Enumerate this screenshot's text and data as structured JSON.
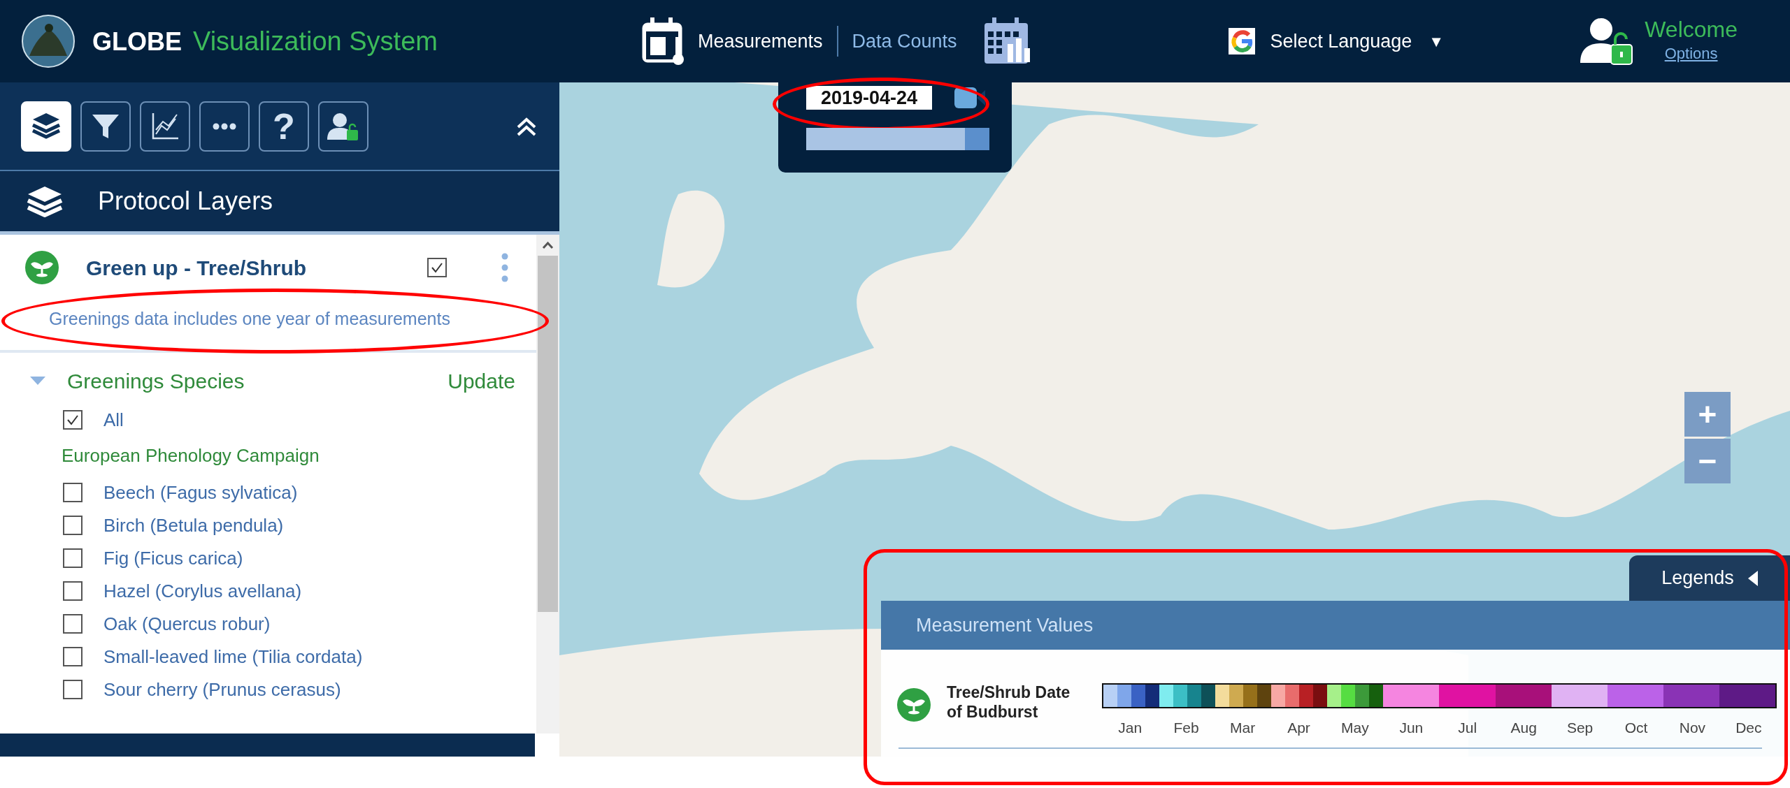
{
  "header": {
    "brand": "GLOBE",
    "subtitle": "Visualization System",
    "views": [
      {
        "kind": "measurements",
        "label": "Measurements",
        "selected": true
      },
      {
        "kind": "counts",
        "label": "Data Counts",
        "selected": false
      }
    ],
    "language": {
      "label": "Select Language",
      "caret": "▼"
    },
    "user": {
      "greeting": "Welcome",
      "link": "Options"
    }
  },
  "toolbar": {
    "buttons": [
      {
        "kind": "layers",
        "selected": true
      },
      {
        "kind": "filter",
        "selected": false
      },
      {
        "kind": "chart",
        "selected": false
      },
      {
        "kind": "more",
        "selected": false
      },
      {
        "kind": "help",
        "glyph": "?",
        "selected": false
      },
      {
        "kind": "user",
        "selected": false
      }
    ]
  },
  "sidebar": {
    "title": "Protocol Layers",
    "layer": {
      "title": "Green up - Tree/Shrub",
      "checked": true,
      "note": "Greenings data includes one year of measurements",
      "note_highlighted": true
    },
    "species": {
      "title": "Greenings Species",
      "expanded": true,
      "action": "Update",
      "items": [
        {
          "kind": "check",
          "label": "All",
          "checked": true
        },
        {
          "kind": "group",
          "label": "European Phenology Campaign"
        },
        {
          "kind": "check",
          "label": "Beech (Fagus sylvatica)",
          "checked": false
        },
        {
          "kind": "check",
          "label": "Birch (Betula pendula)",
          "checked": false
        },
        {
          "kind": "check",
          "label": "Fig (Ficus carica)",
          "checked": false
        },
        {
          "kind": "check",
          "label": "Hazel (Corylus avellana)",
          "checked": false
        },
        {
          "kind": "check",
          "label": "Oak (Quercus robur)",
          "checked": false
        },
        {
          "kind": "check",
          "label": "Small-leaved lime (Tilia cordata)",
          "checked": false
        },
        {
          "kind": "check",
          "label": "Sour cherry (Prunus cerasus)",
          "checked": false
        }
      ]
    }
  },
  "date_control": {
    "date": "2019-04-24",
    "highlighted": true,
    "level": 1.0
  },
  "map": {
    "zoom_buttons": [
      "+",
      "−"
    ]
  },
  "legend": {
    "tab": "Legends",
    "panel_title": "Measurement Values",
    "highlighted": true,
    "entry": {
      "label": "Tree/Shrub Date of Budburst",
      "months": [
        {
          "label": "Jan",
          "swatches": [
            {
              "color": "#b8d0f5"
            },
            {
              "color": "#7fa6ea"
            },
            {
              "color": "#3a62c4"
            },
            {
              "color": "#142c78"
            }
          ]
        },
        {
          "label": "Feb",
          "swatches": [
            {
              "color": "#7fecef"
            },
            {
              "color": "#3cbfc5"
            },
            {
              "color": "#17848e"
            },
            {
              "color": "#0e5058"
            }
          ]
        },
        {
          "label": "Mar",
          "swatches": [
            {
              "color": "#f3dc9c"
            },
            {
              "color": "#cfaa50"
            },
            {
              "color": "#96701a"
            },
            {
              "color": "#5e430e"
            }
          ]
        },
        {
          "label": "Apr",
          "swatches": [
            {
              "color": "#f7a8a4"
            },
            {
              "color": "#e86c6c"
            },
            {
              "color": "#b82024"
            },
            {
              "color": "#7a0e10"
            }
          ]
        },
        {
          "label": "May",
          "swatches": [
            {
              "color": "#a6f08a"
            },
            {
              "color": "#56dd42"
            },
            {
              "color": "#3c9a3a"
            },
            {
              "color": "#16600e"
            }
          ]
        },
        {
          "label": "Jun",
          "swatches": [
            {
              "color": "#f585e0"
            }
          ]
        },
        {
          "label": "Jul",
          "swatches": [
            {
              "color": "#e012a2"
            }
          ]
        },
        {
          "label": "Aug",
          "swatches": [
            {
              "color": "#a8107a"
            }
          ]
        },
        {
          "label": "Sep",
          "swatches": [
            {
              "color": "#e0b2f3"
            }
          ]
        },
        {
          "label": "Oct",
          "swatches": [
            {
              "color": "#bb62e8"
            }
          ]
        },
        {
          "label": "Nov",
          "swatches": [
            {
              "color": "#8a33b5"
            }
          ]
        },
        {
          "label": "Dec",
          "swatches": [
            {
              "color": "#5e1a86"
            }
          ]
        }
      ]
    }
  }
}
